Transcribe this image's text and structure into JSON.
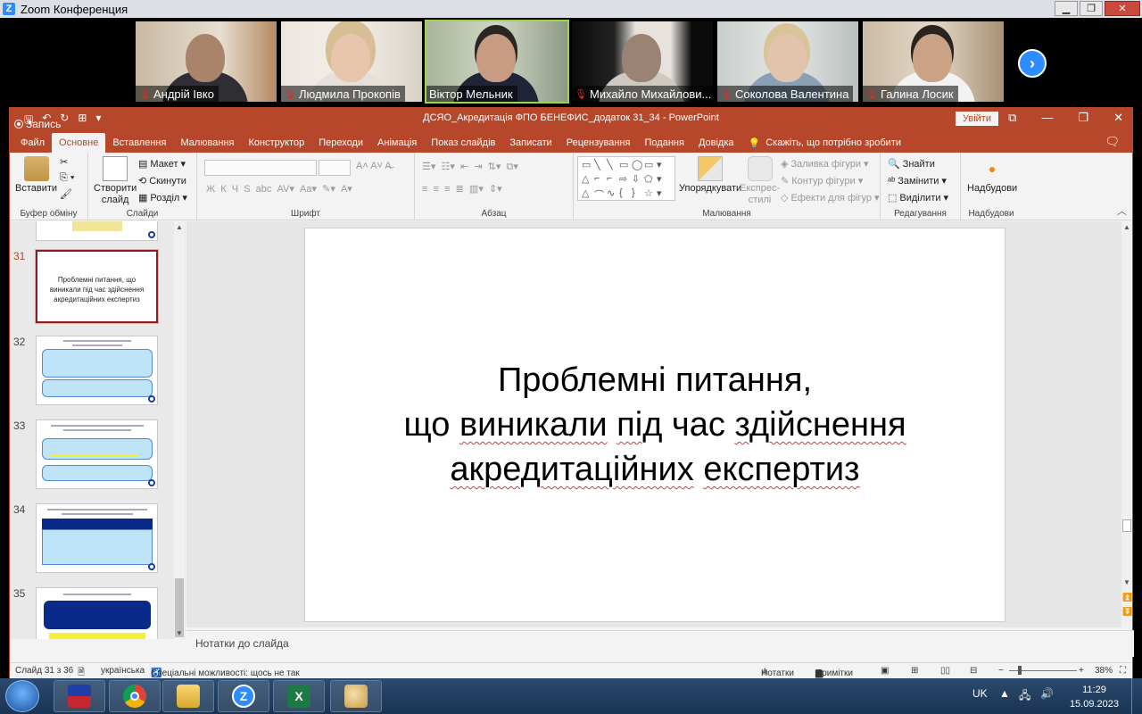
{
  "zoom": {
    "title": "Zoom Конференция",
    "participants": [
      {
        "name": "Андрій Івко",
        "muted": true
      },
      {
        "name": "Людмила Прокопів",
        "muted": true
      },
      {
        "name": "Віктор Мельник",
        "muted": false
      },
      {
        "name": "Михайло Михайлови...",
        "muted": true
      },
      {
        "name": "Соколова Валентина",
        "muted": true
      },
      {
        "name": "Галина Лосик",
        "muted": true
      }
    ]
  },
  "ppt": {
    "recording_label": "Запись",
    "doc_title": "ДСЯО_Акредитація ФПО БЕНЕФИС_додаток 31_34  -  PowerPoint",
    "signin": "Увійти",
    "tabs": [
      "Файл",
      "Основне",
      "Вставлення",
      "Малювання",
      "Конструктор",
      "Переходи",
      "Анімація",
      "Показ слайдів",
      "Записати",
      "Рецензування",
      "Подання",
      "Довідка"
    ],
    "tell_me": "Скажіть, що потрібно зробити",
    "ribbon": {
      "paste": "Вставити",
      "clipboard_group": "Буфер обміну",
      "new_slide_1": "Створити",
      "new_slide_2": "слайд",
      "layout": "Макет",
      "reset": "Скинути",
      "section": "Розділ",
      "slides_group": "Слайди",
      "font_group": "Шрифт",
      "paragraph_group": "Абзац",
      "arrange": "Упорядкувати",
      "quick_styles_1": "Експрес-",
      "quick_styles_2": "стилі",
      "shape_fill": "Заливка фігури",
      "shape_outline": "Контур фігури",
      "shape_effects": "Ефекти для фігур",
      "drawing_group": "Малювання",
      "find": "Знайти",
      "replace": "Замінити",
      "select": "Виділити",
      "editing_group": "Редагування",
      "addins": "Надбудови",
      "addins_group": "Надбудови"
    },
    "slides": [
      {
        "num": "31",
        "text": "Проблемні питання, що виникали під час здійснення акредитаційних експертиз"
      },
      {
        "num": "32",
        "text": ""
      },
      {
        "num": "33",
        "text": ""
      },
      {
        "num": "34",
        "text": ""
      },
      {
        "num": "35",
        "text": ""
      }
    ],
    "current_slide": {
      "line1": "Проблемні питання,",
      "line2a": "що ",
      "line2b": "виникали",
      "line2c": " ",
      "line2d": "під",
      "line2e": " час ",
      "line2f": "здійснення",
      "line3a": "акредитаційних",
      "line3b": " ",
      "line3c": "експертиз"
    },
    "notes_placeholder": "Нотатки до слайда",
    "status": {
      "slide_of": "Слайд 31 з 36",
      "language": "українська",
      "accessibility": "Спеціальні можливості: щось не так",
      "notes": "Нотатки",
      "comments": "Примітки",
      "zoom": "38%"
    }
  },
  "taskbar": {
    "lang": "UK",
    "time": "11:29",
    "date": "15.09.2023"
  }
}
